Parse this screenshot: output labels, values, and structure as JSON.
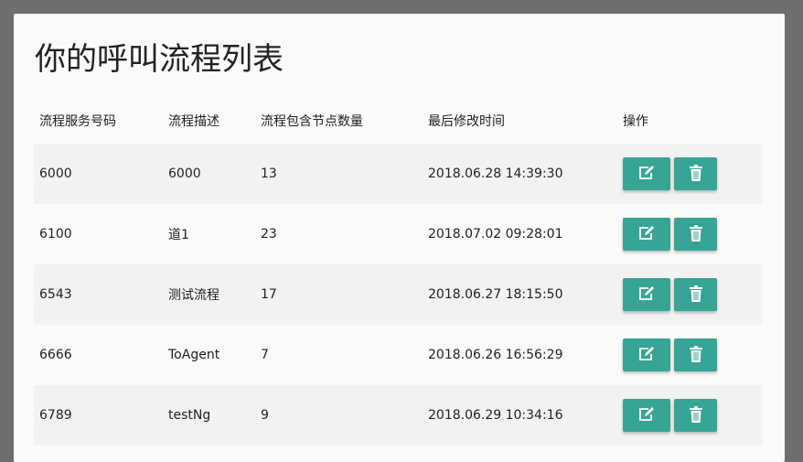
{
  "title": "你的呼叫流程列表",
  "columns": [
    "流程服务号码",
    "流程描述",
    "流程包含节点数量",
    "最后修改时间",
    "操作"
  ],
  "rows": [
    {
      "number": "6000",
      "desc": "6000",
      "nodes": "13",
      "modified": "2018.06.28 14:39:30"
    },
    {
      "number": "6100",
      "desc": "道1",
      "nodes": "23",
      "modified": "2018.07.02 09:28:01"
    },
    {
      "number": "6543",
      "desc": "测试流程",
      "nodes": "17",
      "modified": "2018.06.27 18:15:50"
    },
    {
      "number": "6666",
      "desc": "ToAgent",
      "nodes": "7",
      "modified": "2018.06.26 16:56:29"
    },
    {
      "number": "6789",
      "desc": "testNg",
      "nodes": "9",
      "modified": "2018.06.29 10:34:16"
    }
  ],
  "accent": "#37a595"
}
